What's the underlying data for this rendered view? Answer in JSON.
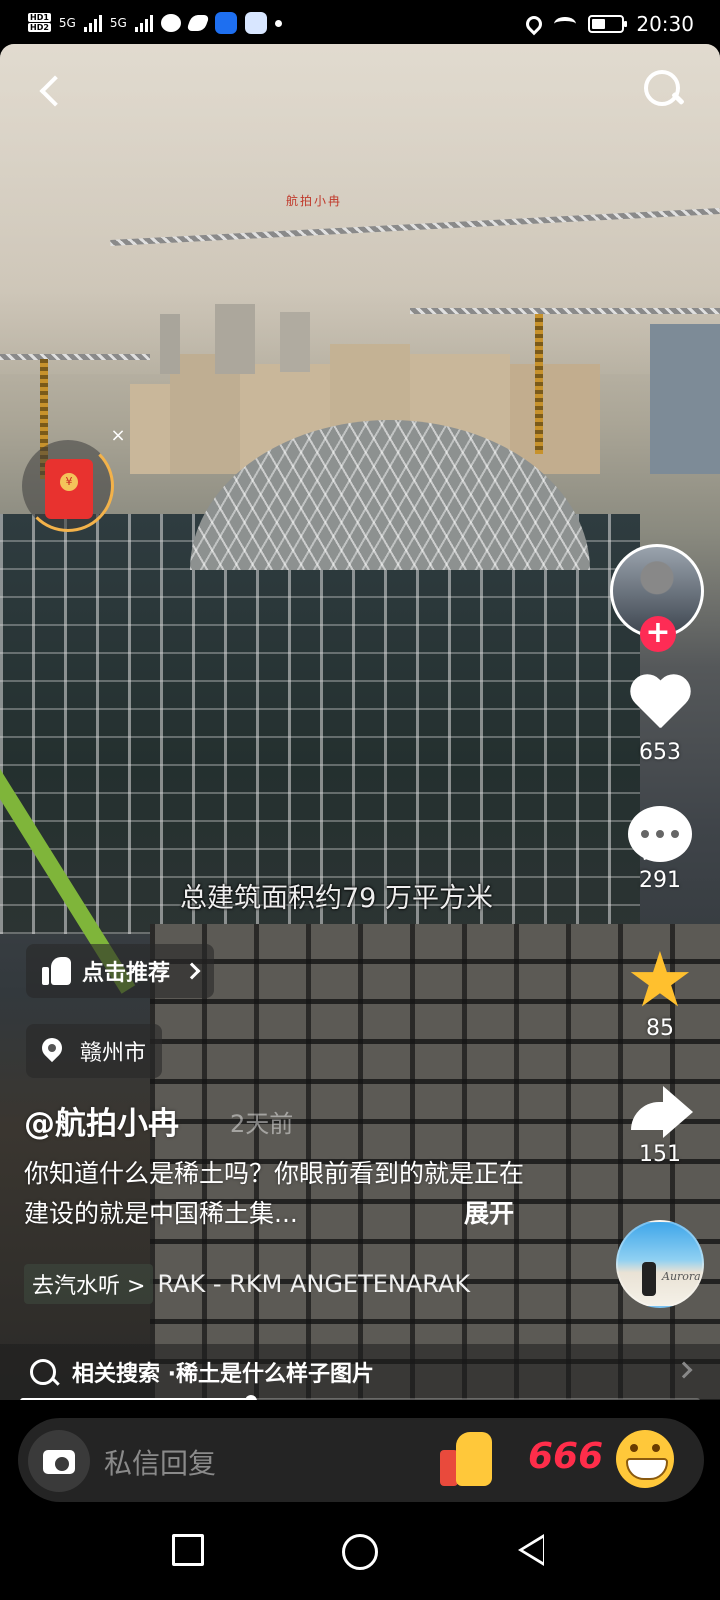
{
  "status_bar": {
    "hd_labels": [
      "HD1",
      "HD2"
    ],
    "network": "5G",
    "network2": "5G",
    "time": "20:30",
    "battery_level": 0.45
  },
  "video": {
    "watermark": "航拍小冉",
    "caption": "总建筑面积约79 万平方米",
    "progress": 0.34
  },
  "actions": {
    "likes": "653",
    "comments": "291",
    "favorites": "85",
    "shares": "151"
  },
  "music_disc": {
    "text": "Aurora"
  },
  "recommend": {
    "label": "点击推荐"
  },
  "location": {
    "label": "赣州市"
  },
  "post": {
    "author": "@航拍小冉",
    "time": "2天前",
    "description": "你知道什么是稀土吗？你眼前看到的就是正在建设的就是中国稀土集...",
    "expand_label": "展开"
  },
  "music": {
    "tag": "去汽水听 >",
    "name": "RAK - RKM    ANGETENARAK"
  },
  "related_search": {
    "prefix": "相关搜索 · ",
    "query": "稀土是什么样子图片"
  },
  "reply": {
    "placeholder": "私信回复",
    "quick_emoji_text": "666"
  }
}
